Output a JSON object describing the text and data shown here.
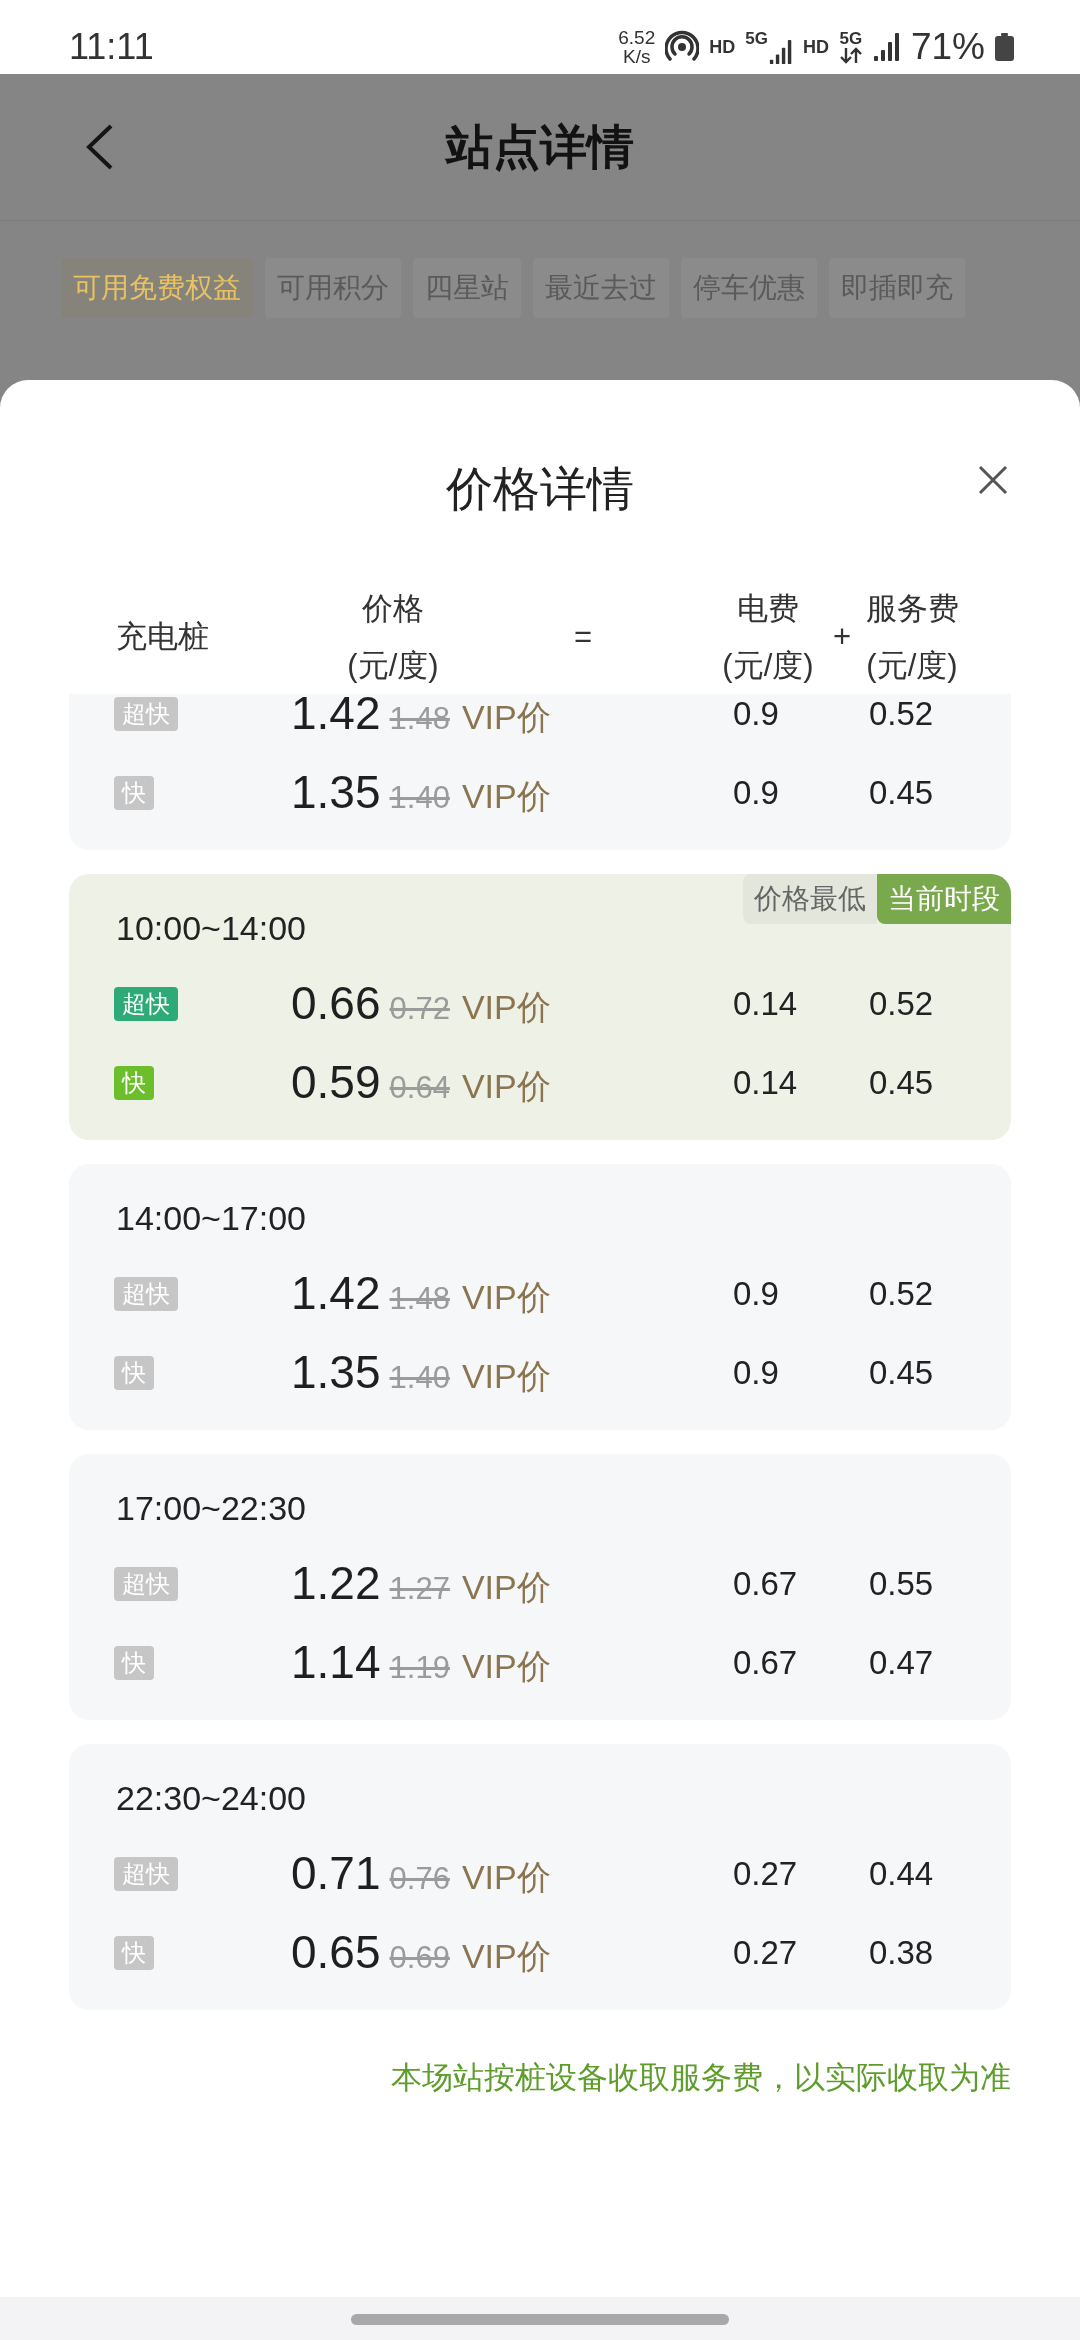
{
  "status_bar": {
    "time": "11:11",
    "speed": "6.52",
    "speed_unit": "K/s",
    "sims": [
      {
        "hd": "HD",
        "network": "5G",
        "data_active": false
      },
      {
        "hd": "HD",
        "network": "5G",
        "data_active": true
      }
    ],
    "battery": "71%"
  },
  "station_page": {
    "title": "站点详情",
    "tags": [
      {
        "label": "可用免费权益",
        "kind": "benefit"
      },
      {
        "label": "可用积分",
        "kind": "plain"
      },
      {
        "label": "四星站",
        "kind": "plain"
      },
      {
        "label": "最近去过",
        "kind": "plain"
      },
      {
        "label": "停车优惠",
        "kind": "plain"
      },
      {
        "label": "即插即充",
        "kind": "plain"
      }
    ]
  },
  "price_sheet": {
    "title": "价格详情",
    "header": {
      "pile": "充电桩",
      "price": {
        "label": "价格",
        "unit": "(元/度)"
      },
      "equals": "=",
      "electricity": {
        "label": "电费",
        "unit": "(元/度)"
      },
      "plus": "+",
      "service": {
        "label": "服务费",
        "unit": "(元/度)"
      }
    },
    "periods": [
      {
        "current": false,
        "rows": [
          {
            "tag": "超快",
            "color": "#c6c6c6",
            "price": "1.42",
            "original_price": "1.48",
            "vip_label": "VIP价",
            "electricity_fee": "0.9",
            "service_fee": "0.52"
          },
          {
            "tag": "快",
            "color": "#c6c6c6",
            "price": "1.35",
            "original_price": "1.40",
            "vip_label": "VIP价",
            "electricity_fee": "0.9",
            "service_fee": "0.45"
          }
        ]
      },
      {
        "time": "10:00~14:00",
        "current": true,
        "badges": [
          {
            "label": "价格最低",
            "kind": "plain"
          },
          {
            "label": "当前时段",
            "kind": "accent"
          }
        ],
        "rows": [
          {
            "tag": "超快",
            "color": "#2daa76",
            "price": "0.66",
            "original_price": "0.72",
            "vip_label": "VIP价",
            "electricity_fee": "0.14",
            "service_fee": "0.52"
          },
          {
            "tag": "快",
            "color": "#6cbf2b",
            "price": "0.59",
            "original_price": "0.64",
            "vip_label": "VIP价",
            "electricity_fee": "0.14",
            "service_fee": "0.45"
          }
        ]
      },
      {
        "time": "14:00~17:00",
        "current": false,
        "rows": [
          {
            "tag": "超快",
            "color": "#c6c6c6",
            "price": "1.42",
            "original_price": "1.48",
            "vip_label": "VIP价",
            "electricity_fee": "0.9",
            "service_fee": "0.52"
          },
          {
            "tag": "快",
            "color": "#c6c6c6",
            "price": "1.35",
            "original_price": "1.40",
            "vip_label": "VIP价",
            "electricity_fee": "0.9",
            "service_fee": "0.45"
          }
        ]
      },
      {
        "time": "17:00~22:30",
        "current": false,
        "rows": [
          {
            "tag": "超快",
            "color": "#c6c6c6",
            "price": "1.22",
            "original_price": "1.27",
            "vip_label": "VIP价",
            "electricity_fee": "0.67",
            "service_fee": "0.55"
          },
          {
            "tag": "快",
            "color": "#c6c6c6",
            "price": "1.14",
            "original_price": "1.19",
            "vip_label": "VIP价",
            "electricity_fee": "0.67",
            "service_fee": "0.47"
          }
        ]
      },
      {
        "time": "22:30~24:00",
        "current": false,
        "rows": [
          {
            "tag": "超快",
            "color": "#c6c6c6",
            "price": "0.71",
            "original_price": "0.76",
            "vip_label": "VIP价",
            "electricity_fee": "0.27",
            "service_fee": "0.44"
          },
          {
            "tag": "快",
            "color": "#c6c6c6",
            "price": "0.65",
            "original_price": "0.69",
            "vip_label": "VIP价",
            "electricity_fee": "0.27",
            "service_fee": "0.38"
          }
        ]
      }
    ],
    "note": "本场站按桩设备收取服务费，以实际收取为准"
  }
}
